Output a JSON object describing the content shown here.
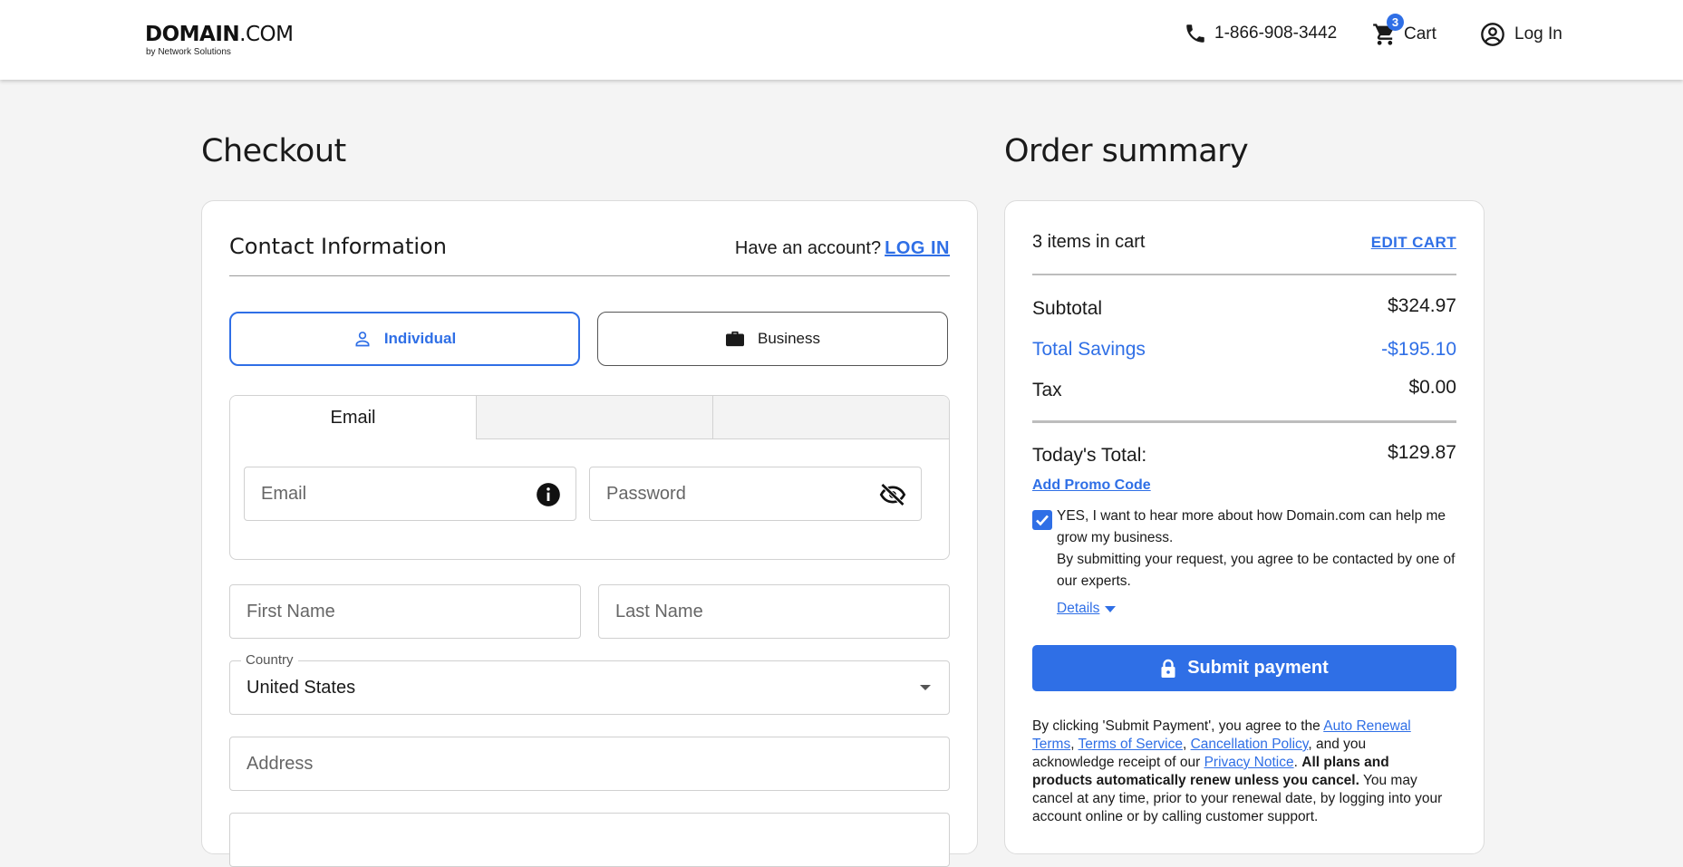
{
  "header": {
    "logo_main": "DOMAIN",
    "logo_dotcom": ".COM",
    "logo_sub": "by Network Solutions",
    "phone": "1-866-908-3442",
    "cart_label": "Cart",
    "cart_count": "3",
    "login_label": "Log In"
  },
  "checkout": {
    "title": "Checkout",
    "contact_title": "Contact Information",
    "have_account_text": "Have an account?",
    "login_link": "LOG IN",
    "individual_label": "Individual",
    "business_label": "Business",
    "tabs": [
      "Email",
      "",
      ""
    ],
    "email_placeholder": "Email",
    "password_placeholder": "Password",
    "first_name_placeholder": "First Name",
    "last_name_placeholder": "Last Name",
    "country_label": "Country",
    "country_value": "United States",
    "address_placeholder": "Address"
  },
  "summary": {
    "title": "Order summary",
    "items_count": "3 items in cart",
    "edit_cart": "EDIT CART",
    "subtotal_label": "Subtotal",
    "subtotal_value": "$324.97",
    "savings_label": "Total Savings",
    "savings_value": "-$195.10",
    "tax_label": "Tax",
    "tax_value": "$0.00",
    "total_label": "Today's Total:",
    "total_value": "$129.87",
    "promo_label": "Add Promo Code",
    "consent_line1": "YES, I want to hear more about how Domain.com can help me grow my business.",
    "consent_line2": "By submitting your request, you agree to be contacted by one of our experts.",
    "details_label": "Details",
    "submit_label": "Submit payment",
    "legal_pre": "By clicking 'Submit Payment', you agree to the ",
    "legal_link1": "Auto Renewal Terms",
    "legal_sep1": ", ",
    "legal_link2": "Terms of Service",
    "legal_sep2": ", ",
    "legal_link3": "Cancellation Policy",
    "legal_mid": ", and you acknowledge receipt of our ",
    "legal_link4": "Privacy Notice",
    "legal_dot": ". ",
    "legal_bold": "All plans and products automatically renew unless you cancel.",
    "legal_post": " You may cancel at any time, prior to your renewal date, by logging into your account online or by calling customer support."
  },
  "colors": {
    "accent": "#2f6fe6",
    "background": "#f4f4f4"
  }
}
